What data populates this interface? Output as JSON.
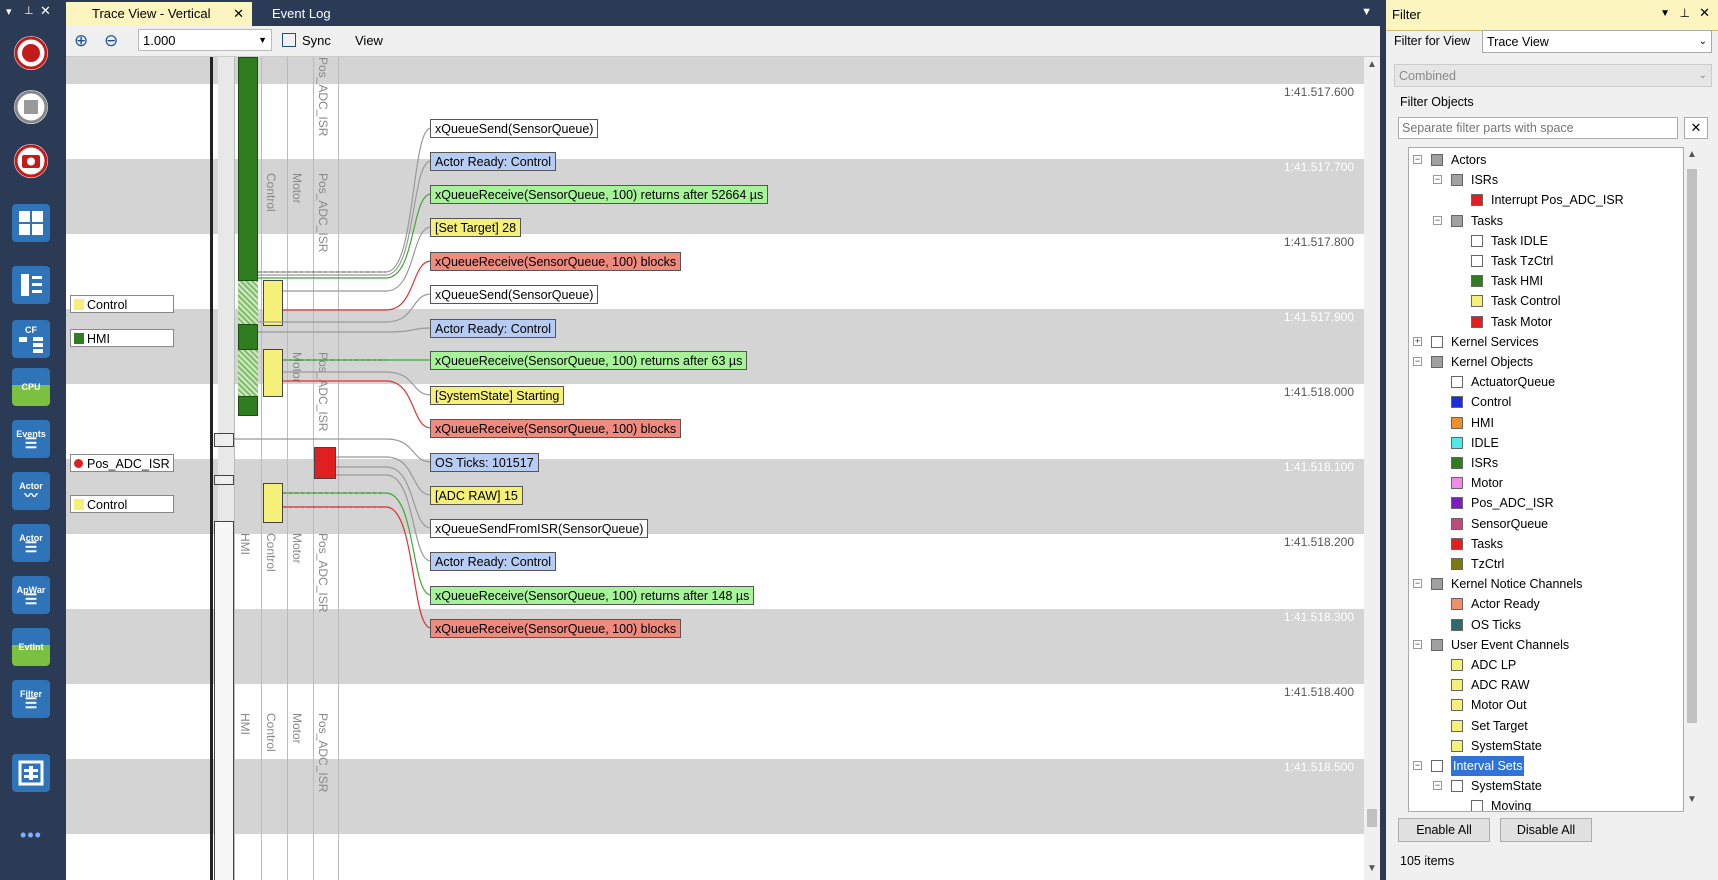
{
  "tabs": {
    "active": "Trace View - Vertical",
    "other": "Event Log"
  },
  "toolbar": {
    "zoom_value": "1.000",
    "sync_label": "Sync",
    "view_label": "View"
  },
  "left_toolbar": {
    "buttons": [
      {
        "name": "record",
        "label": ""
      },
      {
        "name": "stop",
        "label": ""
      },
      {
        "name": "snapshot",
        "label": ""
      },
      {
        "name": "dashboard",
        "label": ""
      },
      {
        "name": "trace-view",
        "label": ""
      },
      {
        "name": "call-flow",
        "label": "CF"
      },
      {
        "name": "cpu-load",
        "label": "CPU"
      },
      {
        "name": "events",
        "label": "Events"
      },
      {
        "name": "actor-graph",
        "label": "Actor"
      },
      {
        "name": "actor-list",
        "label": "Actor"
      },
      {
        "name": "app-warnings",
        "label": "ApWar"
      },
      {
        "name": "event-intervals",
        "label": "EvtInt"
      },
      {
        "name": "filter",
        "label": "Filter"
      },
      {
        "name": "statistics",
        "label": ""
      },
      {
        "name": "more",
        "label": "•••"
      }
    ]
  },
  "trace": {
    "timestamps": [
      "1:41.517.600",
      "1:41.517.700",
      "1:41.517.800",
      "1:41.517.900",
      "1:41.518.000",
      "1:41.518.100",
      "1:41.518.200",
      "1:41.518.300",
      "1:41.518.400",
      "1:41.518.500"
    ],
    "column_labels": {
      "hmi": "HMI",
      "control": "Control",
      "motor": "Motor",
      "pos_adc_isr": "Pos_ADC_ISR"
    },
    "actor_labels": [
      {
        "text": "Control",
        "color": "#f5f07a"
      },
      {
        "text": "HMI",
        "color": "#2e7d1e"
      },
      {
        "text": "Pos_ADC_ISR",
        "color": "#e02020"
      },
      {
        "text": "Control",
        "color": "#f5f07a"
      }
    ],
    "events": [
      {
        "text": "xQueueSend(SensorQueue)",
        "kind": "white"
      },
      {
        "text": "Actor Ready: Control",
        "kind": "blue"
      },
      {
        "text": "xQueueReceive(SensorQueue, 100) returns after 52664 µs",
        "kind": "green"
      },
      {
        "text": "[Set Target] 28",
        "kind": "yellow"
      },
      {
        "text": "xQueueReceive(SensorQueue, 100) blocks",
        "kind": "red"
      },
      {
        "text": "xQueueSend(SensorQueue)",
        "kind": "white"
      },
      {
        "text": "Actor Ready: Control",
        "kind": "blue"
      },
      {
        "text": "xQueueReceive(SensorQueue, 100) returns after 63 µs",
        "kind": "green"
      },
      {
        "text": "[SystemState] Starting",
        "kind": "yellow"
      },
      {
        "text": "xQueueReceive(SensorQueue, 100) blocks",
        "kind": "red"
      },
      {
        "text": "OS Ticks: 101517",
        "kind": "blue"
      },
      {
        "text": "[ADC RAW] 15",
        "kind": "yellow"
      },
      {
        "text": "xQueueSendFromISR(SensorQueue)",
        "kind": "white"
      },
      {
        "text": "Actor Ready: Control",
        "kind": "blue"
      },
      {
        "text": "xQueueReceive(SensorQueue, 100) returns after 148 µs",
        "kind": "green"
      },
      {
        "text": "xQueueReceive(SensorQueue, 100) blocks",
        "kind": "red"
      }
    ]
  },
  "filter": {
    "title": "Filter",
    "filter_for_view_label": "Filter for View",
    "filter_for_view_value": "Trace View",
    "combined_value": "Combined",
    "filter_objects_label": "Filter Objects",
    "search_placeholder": "Separate filter parts with space",
    "tree": [
      {
        "label": "Actors",
        "color": "#a0a0a0"
      },
      {
        "label": "ISRs",
        "color": "#a0a0a0"
      },
      {
        "label": "Interrupt Pos_ADC_ISR",
        "color": "#e02020"
      },
      {
        "label": "Tasks",
        "color": "#a0a0a0"
      },
      {
        "label": "Task IDLE",
        "color": "#ffffff"
      },
      {
        "label": "Task TzCtrl",
        "color": "#ffffff"
      },
      {
        "label": "Task HMI",
        "color": "#2e7d1e"
      },
      {
        "label": "Task Control",
        "color": "#f5f07a"
      },
      {
        "label": "Task Motor",
        "color": "#e02020"
      },
      {
        "label": "Kernel Services",
        "color": "#ffffff"
      },
      {
        "label": "Kernel Objects",
        "color": "#a0a0a0"
      },
      {
        "label": "ActuatorQueue",
        "color": "#ffffff"
      },
      {
        "label": "Control",
        "color": "#1a2ee0"
      },
      {
        "label": "HMI",
        "color": "#f0902a"
      },
      {
        "label": "IDLE",
        "color": "#4ee8e8"
      },
      {
        "label": "ISRs",
        "color": "#2e7d1e"
      },
      {
        "label": "Motor",
        "color": "#f08ce8"
      },
      {
        "label": "Pos_ADC_ISR",
        "color": "#7a1ec0"
      },
      {
        "label": "SensorQueue",
        "color": "#c04a7a"
      },
      {
        "label": "Tasks",
        "color": "#e02020"
      },
      {
        "label": "TzCtrl",
        "color": "#7a7a10"
      },
      {
        "label": "Kernel Notice Channels",
        "color": "#a0a0a0"
      },
      {
        "label": "Actor Ready",
        "color": "#f0906a"
      },
      {
        "label": "OS Ticks",
        "color": "#2e6a6a"
      },
      {
        "label": "User Event Channels",
        "color": "#a0a0a0"
      },
      {
        "label": "ADC LP",
        "color": "#f5f07a"
      },
      {
        "label": "ADC RAW",
        "color": "#f5f07a"
      },
      {
        "label": "Motor Out",
        "color": "#f5f07a"
      },
      {
        "label": "Set Target",
        "color": "#f5f07a"
      },
      {
        "label": "SystemState",
        "color": "#f5f07a"
      },
      {
        "label": "Interval Sets",
        "color": "#ffffff"
      },
      {
        "label": "SystemState",
        "color": "#ffffff"
      },
      {
        "label": "Moving",
        "color": "#ffffff"
      }
    ],
    "enable_all": "Enable All",
    "disable_all": "Disable All",
    "item_count": "105 items"
  }
}
